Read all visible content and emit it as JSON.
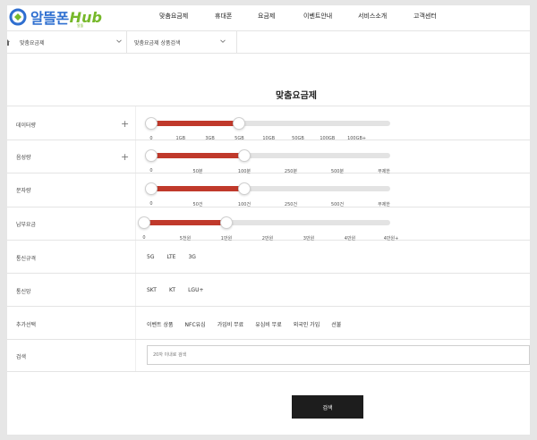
{
  "logo": {
    "name": "알뜰폰",
    "hub": "Hub",
    "sub": "알뜰"
  },
  "nav": [
    {
      "label": "맞춤요금제"
    },
    {
      "label": "휴대폰"
    },
    {
      "label": "요금제"
    },
    {
      "label": "이벤트안내"
    },
    {
      "label": "서비스소개"
    },
    {
      "label": "고객센터"
    }
  ],
  "breadcrumb": {
    "level1": "맞춤요금제",
    "level2": "맞춤요금제 상품검색"
  },
  "page_title": "맞춤요금제",
  "filters": {
    "data": {
      "label": "데이터량",
      "ticks": [
        "0",
        "1GB",
        "3GB",
        "5GB",
        "10GB",
        "50GB",
        "100GB",
        "100GB+"
      ],
      "range": [
        0,
        3
      ]
    },
    "voice": {
      "label": "음성량",
      "ticks": [
        "0",
        "50분",
        "100분",
        "250분",
        "500분",
        "무제한"
      ],
      "range": [
        0,
        2
      ]
    },
    "sms": {
      "label": "문자량",
      "ticks": [
        "0",
        "50건",
        "100건",
        "250건",
        "500건",
        "무제한"
      ],
      "range": [
        0,
        2
      ]
    },
    "fee": {
      "label": "납부요금",
      "ticks": [
        "0",
        "5천원",
        "1만원",
        "2만원",
        "3만원",
        "4만원",
        "4만원+"
      ],
      "range": [
        0,
        2
      ]
    },
    "network": {
      "label": "통신규격",
      "options": [
        "5G",
        "LTE",
        "3G"
      ]
    },
    "carrier": {
      "label": "통신망",
      "options": [
        "SKT",
        "KT",
        "LGU+"
      ]
    },
    "extra": {
      "label": "추가선택",
      "options": [
        "이벤트 상품",
        "NFC유심",
        "가입비 무료",
        "유심비 무료",
        "외국인 가입",
        "선불"
      ]
    },
    "search": {
      "label": "검색",
      "placeholder": "20자 이내로 검색"
    }
  },
  "search_button": "검색",
  "colors": {
    "accent": "#c0392b",
    "logo_blue": "#2f6fd0",
    "logo_green": "#76b82a",
    "button": "#1d1d1d"
  }
}
